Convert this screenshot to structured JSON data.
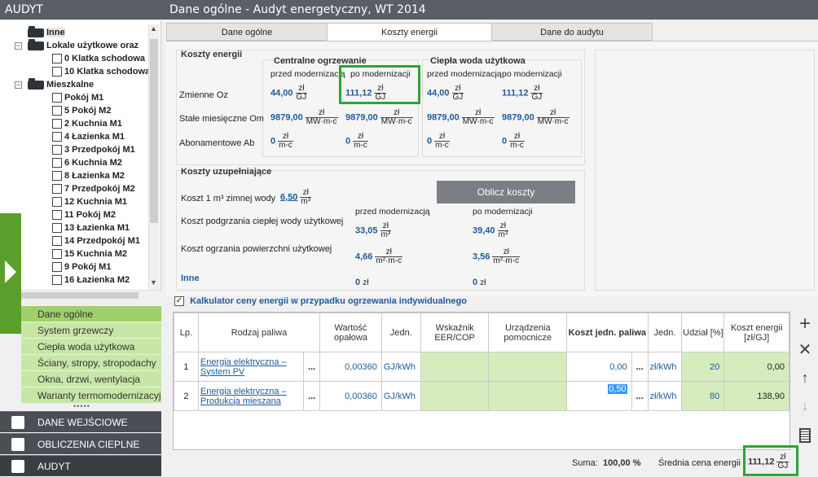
{
  "left_header": "AUDYT",
  "main_header": "Dane ogólne - Audyt energetyczny, WT 2014",
  "tree": [
    {
      "label": "Inne",
      "type": "folder",
      "indent": 1
    },
    {
      "label": "Lokale użytkowe oraz",
      "type": "folder",
      "indent": 1
    },
    {
      "label": "0 Klatka schodowa",
      "type": "doc",
      "indent": 2
    },
    {
      "label": "10 Klatka schodowa",
      "type": "doc",
      "indent": 2
    },
    {
      "label": "Mieszkalne",
      "type": "folder",
      "indent": 1
    },
    {
      "label": "Pokój M1",
      "type": "doc",
      "indent": 2
    },
    {
      "label": "5 Pokój M2",
      "type": "doc",
      "indent": 2
    },
    {
      "label": "2 Kuchnia M1",
      "type": "doc",
      "indent": 2
    },
    {
      "label": "4 Łazienka M1",
      "type": "doc",
      "indent": 2
    },
    {
      "label": "3 Przedpokój M1",
      "type": "doc",
      "indent": 2
    },
    {
      "label": "6 Kuchnia M2",
      "type": "doc",
      "indent": 2
    },
    {
      "label": "8 Łazienka M2",
      "type": "doc",
      "indent": 2
    },
    {
      "label": "7 Przedpokój M2",
      "type": "doc",
      "indent": 2
    },
    {
      "label": "12 Kuchnia M1",
      "type": "doc",
      "indent": 2
    },
    {
      "label": "11 Pokój M2",
      "type": "doc",
      "indent": 2
    },
    {
      "label": "13 Łazienka M1",
      "type": "doc",
      "indent": 2
    },
    {
      "label": "14 Przedpokój M1",
      "type": "doc",
      "indent": 2
    },
    {
      "label": "15 Kuchnia M2",
      "type": "doc",
      "indent": 2
    },
    {
      "label": "9 Pokój M1",
      "type": "doc",
      "indent": 2
    },
    {
      "label": "16 Łazienka M2",
      "type": "doc",
      "indent": 2
    }
  ],
  "nav_items": [
    "Dane ogólne",
    "System grzewczy",
    "Ciepła woda użytkowa",
    "Ściany, stropy, stropodachy",
    "Okna, drzwi, wentylacja",
    "Warianty termomodernizacyjne"
  ],
  "bottom_nav": [
    "DANE WEJŚCIOWE",
    "OBLICZENIA CIEPLNE",
    "AUDYT"
  ],
  "tabs": [
    "Dane ogólne",
    "Koszty energii",
    "Dane do audytu"
  ],
  "energy": {
    "section_title": "Koszty energii",
    "central_title": "Centralne ogrzewanie",
    "cwu_title": "Ciepła woda użytkowa",
    "before_label": "przed modernizacją",
    "after_label": "po modernizacji",
    "row_labels": [
      "Zmienne Oz",
      "Stałe miesięczne Om",
      "Abonamentowe Ab"
    ],
    "units": {
      "zl": "zł",
      "gj": "GJ",
      "mwmc": "MW·m-c",
      "mc": "m-c",
      "m3": "m³",
      "m2mc": "m²·m-c"
    },
    "values": {
      "co_before": [
        "44,00",
        "9879,00",
        "0"
      ],
      "co_after": [
        "111,12",
        "9879,00",
        "0"
      ],
      "cwu_before": [
        "44,00",
        "9879,00",
        "0"
      ],
      "cwu_after": [
        "111,12",
        "9879,00",
        "0"
      ]
    }
  },
  "extra": {
    "title": "Koszty uzupełniające",
    "cold_water_label": "Koszt 1 m³ zimnej wody",
    "cold_water_value": "6,50",
    "calc_button": "Oblicz koszty",
    "before_label": "przed modernizacją",
    "after_label": "po modernizacji",
    "hot_water_label": "Koszt podgrzania ciepłej wody użytkowej",
    "hot_water_before": "33,05",
    "hot_water_after": "39,40",
    "area_label": "Koszt ogrzania powierzchni użytkowej",
    "area_before": "4,66",
    "area_after": "3,56",
    "other_label": "Inne",
    "other_before": "0",
    "other_after": "0"
  },
  "calculator": {
    "checked": true,
    "label": "Kalkulator ceny energii w przypadku ogrzewania indywidualnego",
    "columns": [
      "Lp.",
      "Rodzaj paliwa",
      "Wartość opałowa",
      "Jedn.",
      "Wskaźnik EER/COP",
      "Urządzenia pomocnicze",
      "Koszt jedn. paliwa",
      "Jedn.",
      "Udział [%]",
      "Koszt energii [zł/GJ]"
    ],
    "rows": [
      {
        "lp": "1",
        "fuel": "Energia elektryczna – System PV",
        "dots": "...",
        "heat_value": "0,00360",
        "unit": "GJ/kWh",
        "cost": "0,00",
        "dots2": "...",
        "cost_unit": "zł/kWh",
        "share": "20",
        "energy_cost": "0,00"
      },
      {
        "lp": "2",
        "fuel": "Energia elektryczna – Produkcja mieszana",
        "dots": "...",
        "heat_value": "0,00360",
        "unit": "GJ/kWh",
        "cost": "0,50",
        "dots2": "...",
        "cost_unit": "zł/kWh",
        "share": "80",
        "energy_cost": "138,90"
      }
    ]
  },
  "footer": {
    "sum_label": "Suma:",
    "sum_value": "100,00 %",
    "avg_label": "Średnia cena energii",
    "avg_value": "111,12"
  },
  "side_buttons": [
    "plus-icon",
    "close-icon",
    "arrow-up-icon",
    "arrow-down-icon",
    "calculator-icon"
  ],
  "colors": {
    "header_bg": "#5a5f66",
    "accent_green": "#5a9e2b",
    "highlight_box": "#2fa336",
    "cell_green": "#d7ecbd",
    "link_blue": "#1f5a9a"
  }
}
